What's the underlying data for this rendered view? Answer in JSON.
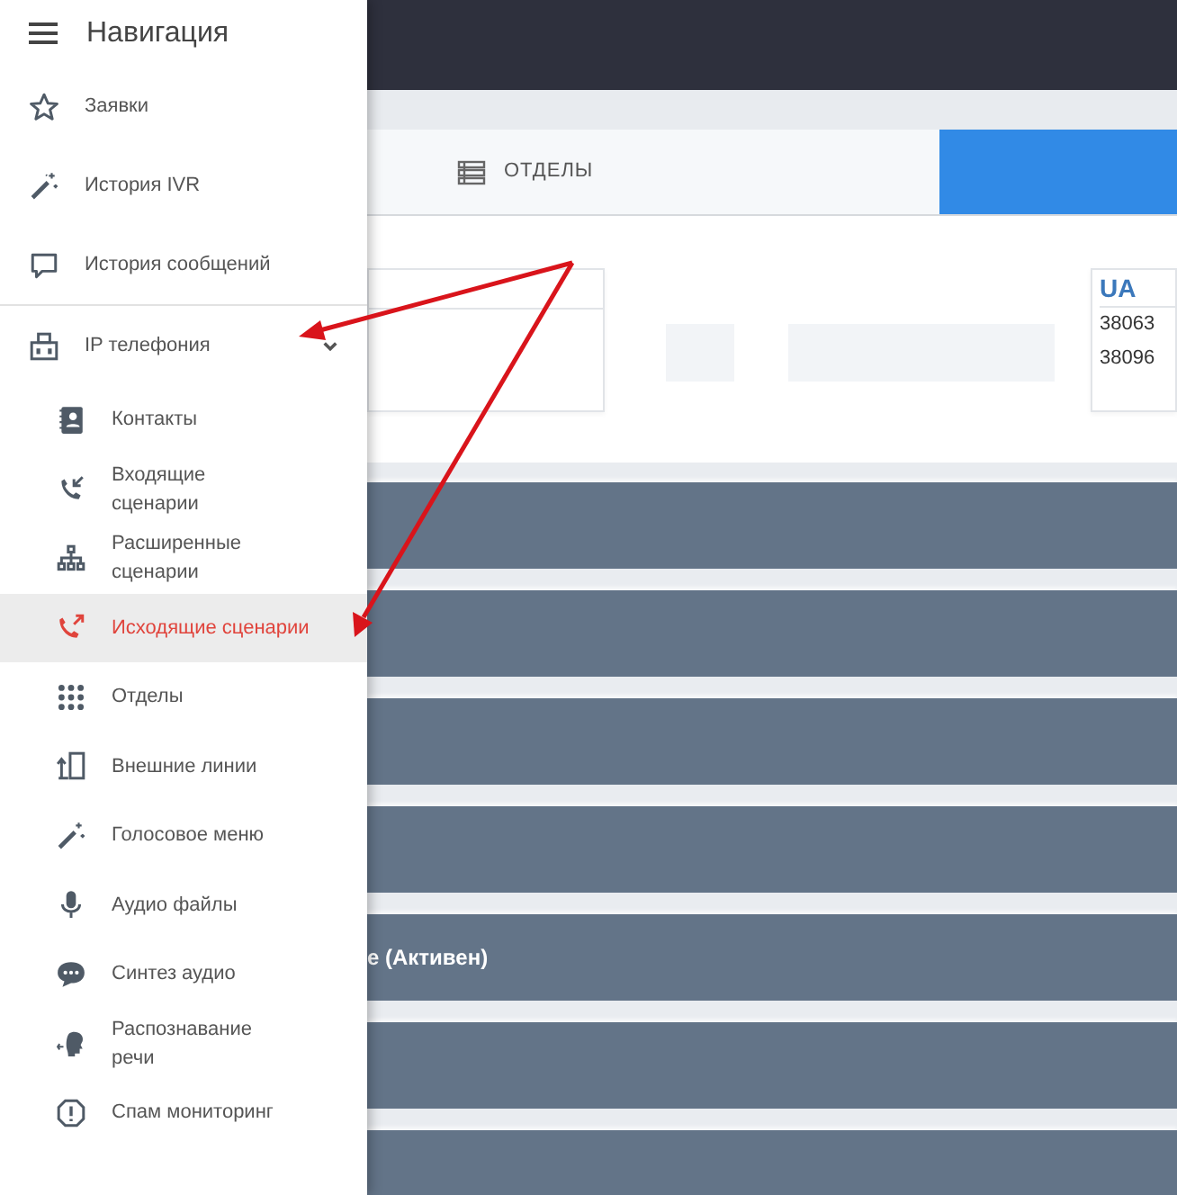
{
  "sidebar": {
    "title": "Навигация",
    "items": [
      {
        "label": "Заявки",
        "selected": false
      },
      {
        "label": "История IVR",
        "selected": false
      },
      {
        "label": "История сообщений",
        "selected": false
      },
      {
        "label": "IP телефония",
        "selected": false,
        "expanded": true,
        "children": [
          {
            "label": "Контакты",
            "selected": false
          },
          {
            "label": "Входящие сценарии",
            "selected": false
          },
          {
            "label": "Расширенные сценарии",
            "selected": false
          },
          {
            "label": "Исходящие сценарии",
            "selected": true
          },
          {
            "label": "Отделы",
            "selected": false
          },
          {
            "label": "Внешние линии",
            "selected": false
          },
          {
            "label": "Голосовое меню",
            "selected": false
          },
          {
            "label": "Аудио файлы",
            "selected": false
          },
          {
            "label": "Синтез аудио",
            "selected": false
          },
          {
            "label": "Распознавание речи",
            "selected": false
          },
          {
            "label": "Спам мониторинг",
            "selected": false
          }
        ]
      }
    ]
  },
  "tabs": [
    {
      "label": "ОТДЕЛЫ",
      "selected": false
    },
    {
      "selected": true
    }
  ],
  "cards": [
    {
      "kind": "blank"
    },
    {
      "kind": "numbers",
      "title": "UA",
      "lines": [
        "38063",
        "38096"
      ]
    }
  ],
  "rows": [
    {},
    {},
    {},
    {},
    {
      "label": "е (Активен)"
    },
    {},
    {}
  ]
}
